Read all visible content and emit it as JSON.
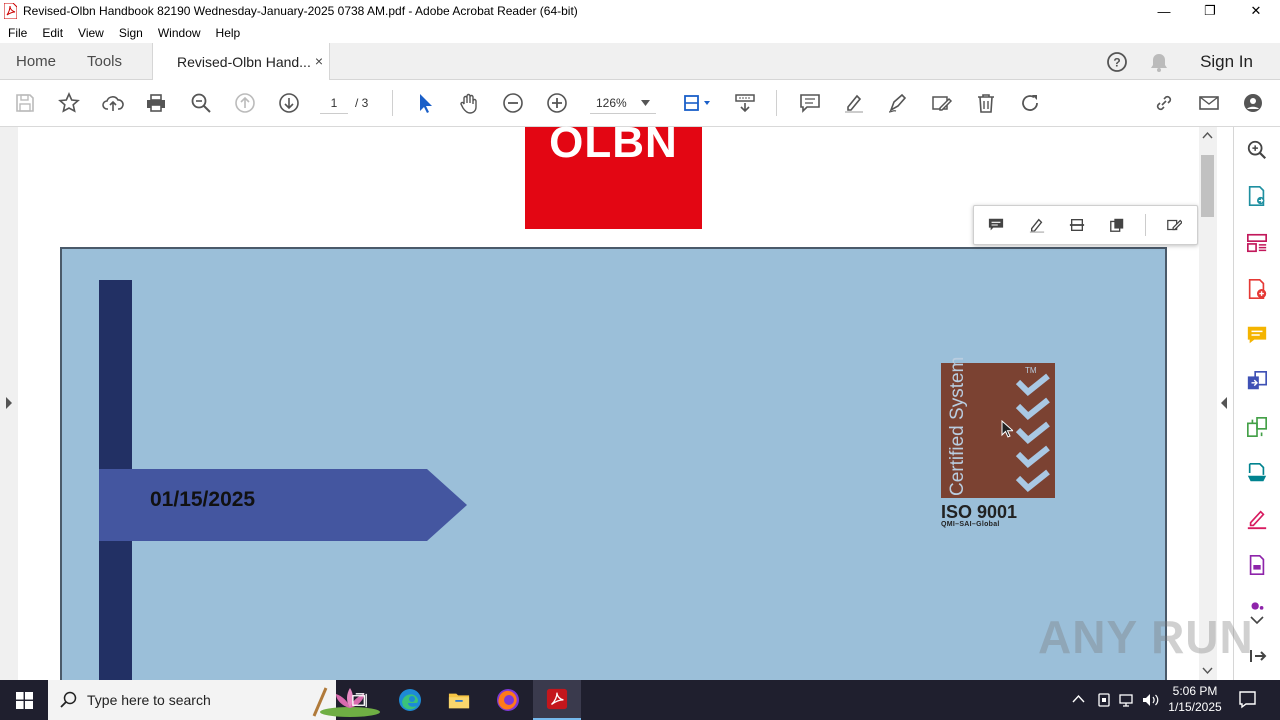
{
  "window": {
    "title": "Revised-Olbn Handbook 82190 Wednesday-January-2025 0738 AM.pdf - Adobe Acrobat Reader (64-bit)",
    "minimize_glyph": "—",
    "maximize_glyph": "❐",
    "close_glyph": "✕"
  },
  "menu": [
    "File",
    "Edit",
    "View",
    "Sign",
    "Window",
    "Help"
  ],
  "tabs": {
    "home": "Home",
    "tools": "Tools",
    "document": "Revised-Olbn Hand...",
    "close_glyph": "×",
    "sign_in": "Sign In"
  },
  "toolbar": {
    "page_current": "1",
    "page_total": "/ 3",
    "zoom": "126%"
  },
  "document": {
    "logo_text": "OLBN",
    "date": "01/15/2025",
    "iso_vertical": "Certified System",
    "iso_tm": "TM",
    "iso_title": "ISO 9001",
    "iso_subtitle": "QMI–SAI–Global"
  },
  "watermark": "ANY RUN",
  "taskbar": {
    "search_placeholder": "Type here to search",
    "time": "5:06 PM",
    "date": "1/15/2025"
  },
  "colors": {
    "accent_red": "#e30613",
    "page_blue": "#9bbfd9",
    "navy_bar": "#223064",
    "arrow_blue": "#4456a0",
    "iso_brown": "#7b4232"
  }
}
